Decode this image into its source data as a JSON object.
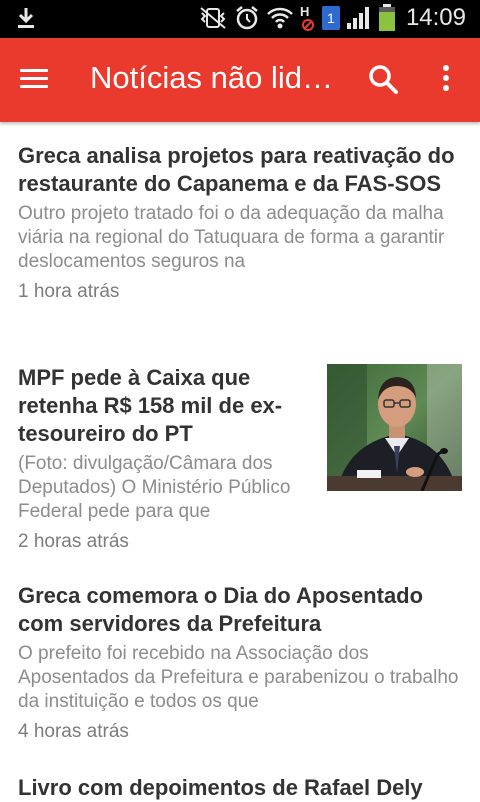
{
  "status_bar": {
    "time": "14:09",
    "sim_badge": "1",
    "network_badge": "H",
    "icons": [
      "download-icon",
      "mute-vibrate-icon",
      "alarm-icon",
      "wifi-icon",
      "signal-icon",
      "battery-icon"
    ]
  },
  "app_bar": {
    "title": "Notícias não lida…",
    "background": "#ea3a2e",
    "icons": [
      "menu-icon",
      "search-icon",
      "more-vertical-icon"
    ]
  },
  "articles": [
    {
      "headline": "Greca analisa projetos para reativação do restaurante do Capanema e da FAS-SOS",
      "snippet": "Outro projeto tratado foi o da adequação da malha viária na regional do Tatuquara de forma a garantir deslocamentos seguros na",
      "time": "1 hora atrás"
    },
    {
      "headline": "MPF pede à Caixa que retenha R$ 158 mil de ex-tesoureiro do PT",
      "snippet": "(Foto: divulgação/Câmara dos Deputados) O Ministério Público Federal pede para que",
      "time": "2 horas atrás",
      "thumbnail": "man-in-suit-photo"
    },
    {
      "headline": "Greca comemora o Dia do Aposentado com servidores da Prefeitura",
      "snippet": "O prefeito foi recebido na Associação dos Aposentados da Prefeitura e parabenizou o trabalho da instituição e todos os que",
      "time": "4 horas atrás"
    },
    {
      "headline": "Livro com depoimentos de Rafael Dely"
    }
  ]
}
